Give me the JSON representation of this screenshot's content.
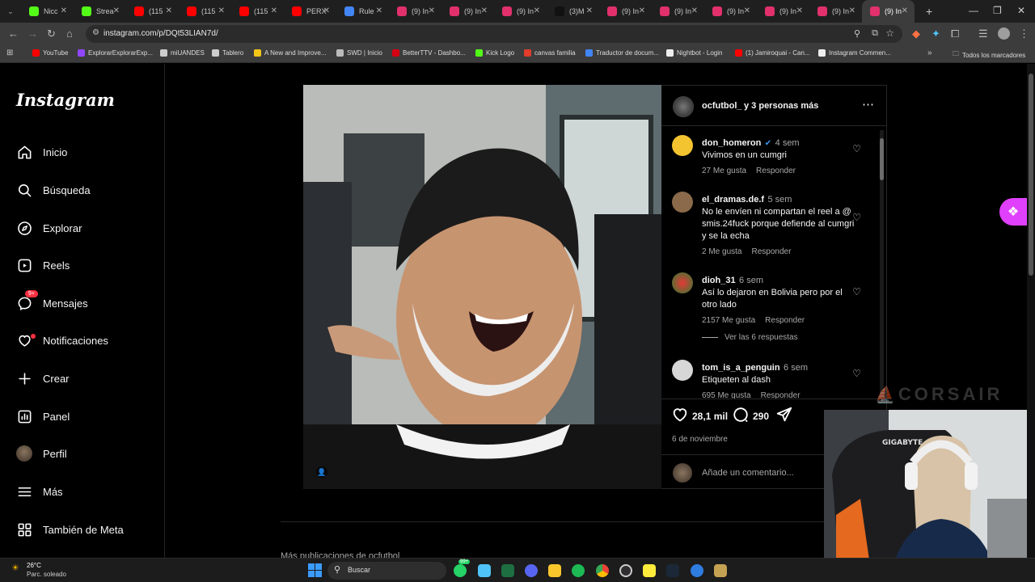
{
  "browser": {
    "tabs": [
      {
        "title": "Nicc",
        "color": "#53fc18"
      },
      {
        "title": "Strea",
        "color": "#53fc18"
      },
      {
        "title": "(115",
        "color": "#ff0000"
      },
      {
        "title": "(115",
        "color": "#ff0000"
      },
      {
        "title": "(115",
        "color": "#ff0000"
      },
      {
        "title": "PERX",
        "color": "#ff0000"
      },
      {
        "title": "Rule",
        "color": "#4285f4"
      },
      {
        "title": "(9) In",
        "color": "#e1306c"
      },
      {
        "title": "(9) In",
        "color": "#e1306c"
      },
      {
        "title": "(9) In",
        "color": "#e1306c"
      },
      {
        "title": "(3)M",
        "color": "#111111"
      },
      {
        "title": "(9) In",
        "color": "#e1306c"
      },
      {
        "title": "(9) In",
        "color": "#e1306c"
      },
      {
        "title": "(9) In",
        "color": "#e1306c"
      },
      {
        "title": "(9) In",
        "color": "#e1306c"
      },
      {
        "title": "(9) In",
        "color": "#e1306c"
      },
      {
        "title": "(9) In",
        "color": "#e1306c"
      }
    ],
    "new_tab": "+",
    "url": "instagram.com/p/DQt53LIAN7d/",
    "bookmarks": [
      {
        "label": "YouTube",
        "color": "#ff0000"
      },
      {
        "label": "ExplorarExplorarExp...",
        "color": "#9146ff"
      },
      {
        "label": "miUANDES",
        "color": "#cccccc"
      },
      {
        "label": "Tablero",
        "color": "#cccccc"
      },
      {
        "label": "A New and Improve...",
        "color": "#f5c518"
      },
      {
        "label": "SWD | Inicio",
        "color": "#bbbbbb"
      },
      {
        "label": "BetterTTV - Dashbo...",
        "color": "#d50014"
      },
      {
        "label": "Kick Logo",
        "color": "#53fc18"
      },
      {
        "label": "canvas familia",
        "color": "#e13c2c"
      },
      {
        "label": "Traductor de docum...",
        "color": "#4285f4"
      },
      {
        "label": "Nightbot - Login",
        "color": "#eeeeee"
      },
      {
        "label": "(1) Jamiroquai - Can...",
        "color": "#ff0000"
      },
      {
        "label": "Instagram Commen...",
        "color": "#eeeeee"
      }
    ],
    "all_bookmarks": "Todos los marcadores"
  },
  "sidebar": {
    "logo": "Instagram",
    "items": [
      {
        "label": "Inicio",
        "icon": "home-icon"
      },
      {
        "label": "Búsqueda",
        "icon": "search-icon"
      },
      {
        "label": "Explorar",
        "icon": "compass-icon"
      },
      {
        "label": "Reels",
        "icon": "reels-icon"
      },
      {
        "label": "Mensajes",
        "icon": "messenger-icon"
      },
      {
        "label": "Notificaciones",
        "icon": "heart-icon"
      },
      {
        "label": "Crear",
        "icon": "plus-icon"
      },
      {
        "label": "Panel",
        "icon": "dashboard-icon"
      },
      {
        "label": "Perfil",
        "icon": "profile-avatar"
      },
      {
        "label": "Más",
        "icon": "menu-icon"
      },
      {
        "label": "También de Meta",
        "icon": "meta-icon"
      }
    ],
    "messages_badge": "9+"
  },
  "post": {
    "author": "ocfutbol_",
    "coauthors": "y 3 personas más",
    "likes": "28,1 mil",
    "comments_count": "290",
    "date": "6 de noviembre",
    "add_comment_placeholder": "Añade un comentario...",
    "more_posts": "Más publicaciones de ocfutbol_"
  },
  "comments": [
    {
      "user": "don_homeron",
      "verified": true,
      "time": "4 sem",
      "text": "Vivimos en un cumgri",
      "likes": "27 Me gusta",
      "reply": "Responder",
      "avatar_color": "#f4c430"
    },
    {
      "user": "el_dramas.de.f",
      "verified": false,
      "time": "5 sem",
      "text": "No le envíen ni compartan el reel a @ smis.24fuck porque defiende al cumgri y se la echa",
      "likes": "2 Me gusta",
      "reply": "Responder",
      "avatar_color": "#8a6a4a"
    },
    {
      "user": "dioh_31",
      "verified": false,
      "time": "6 sem",
      "text": "Así lo dejaron en Bolivia pero por el otro lado",
      "likes": "2157 Me gusta",
      "reply": "Responder",
      "view_replies": "Ver las 6 respuestas",
      "avatar_color": "#2e7d32"
    },
    {
      "user": "tom_is_a_penguin",
      "verified": false,
      "time": "6 sem",
      "text": "Etiqueten al dash",
      "likes": "695 Me gusta",
      "reply": "Responder",
      "avatar_color": "#cccccc"
    }
  ],
  "overlay": {
    "watermark": "CORSAIR",
    "chair_brand": "GIGABYTE"
  },
  "taskbar": {
    "weather_temp": "26°C",
    "weather_desc": "Parc. soleado",
    "search_placeholder": "Buscar",
    "whatsapp_badge": "99+"
  }
}
